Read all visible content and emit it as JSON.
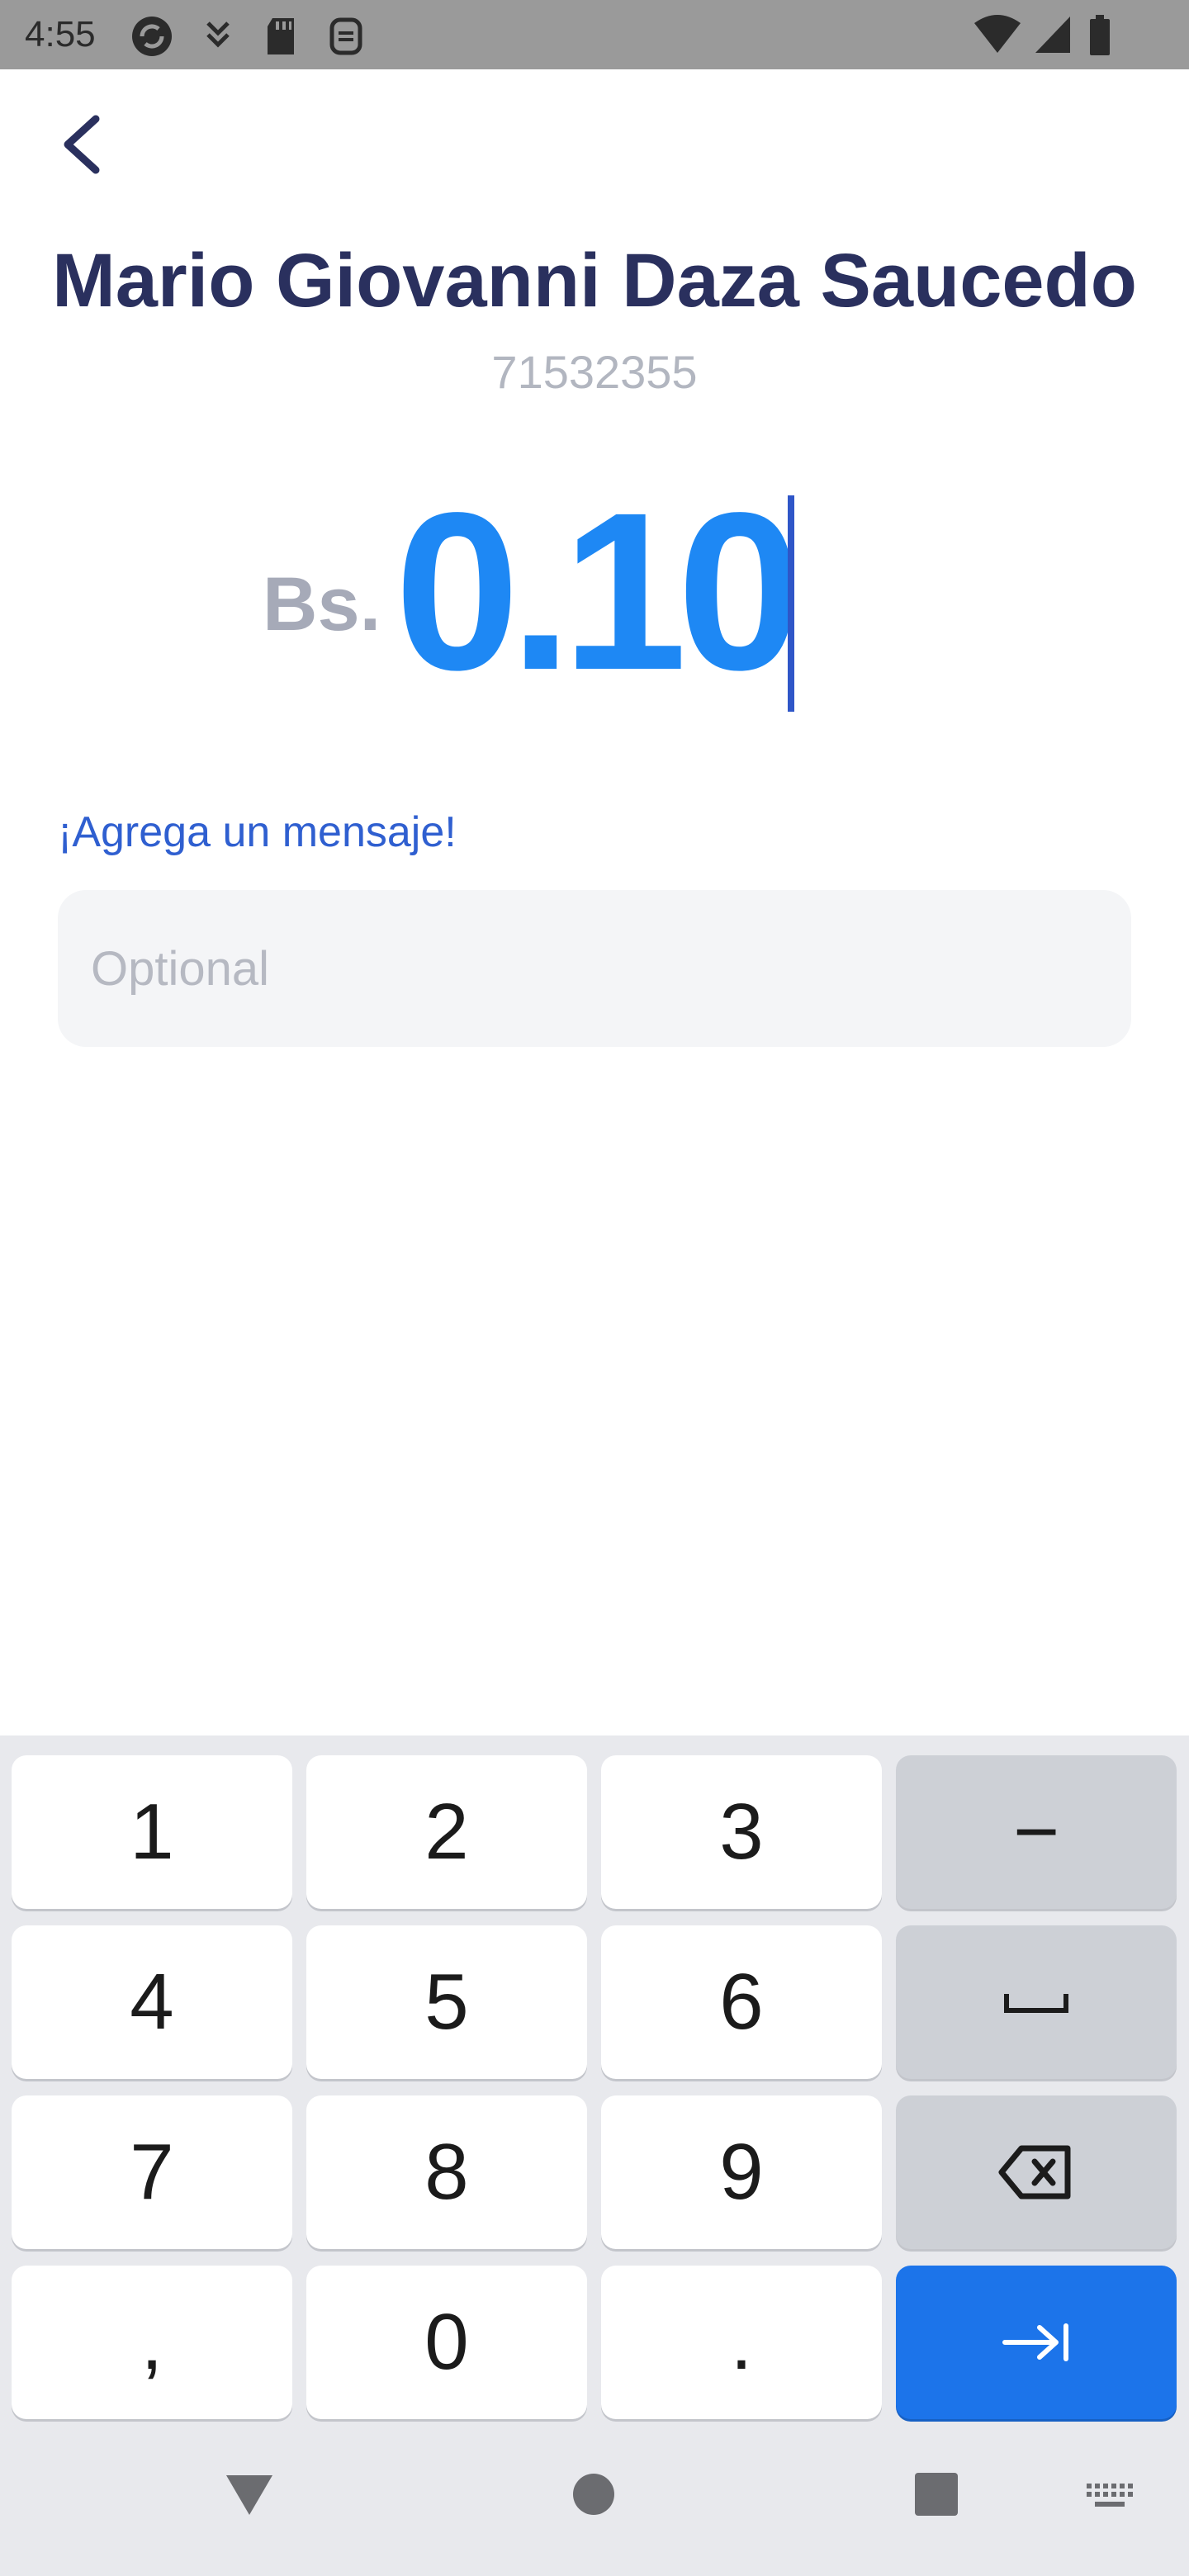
{
  "status_bar": {
    "time": "4:55"
  },
  "header": {
    "back_icon": "chevron-left-icon"
  },
  "recipient": {
    "name": "Mario Giovanni Daza Saucedo",
    "phone": "71532355"
  },
  "amount": {
    "currency": "Bs.",
    "value": "0.10"
  },
  "message": {
    "label": "¡Agrega un mensaje!",
    "placeholder": "Optional",
    "value": ""
  },
  "keyboard": {
    "keys": [
      "1",
      "2",
      "3",
      "−",
      "4",
      "5",
      "6",
      "7",
      "8",
      "9",
      ",",
      "0",
      "."
    ],
    "space_icon": "space-bar-icon",
    "backspace_icon": "backspace-icon",
    "next_icon": "tab-next-icon"
  },
  "colors": {
    "accent": "#1e88f4",
    "name": "#2a305e",
    "label": "#2f5fd0",
    "action_key": "#1c74ea"
  }
}
